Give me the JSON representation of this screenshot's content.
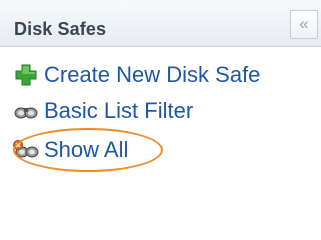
{
  "panel": {
    "title": "Disk Safes",
    "collapse_glyph": "«"
  },
  "menu": {
    "items": [
      {
        "label": "Create New Disk Safe",
        "icon": "add-icon",
        "color": "#3aa63a"
      },
      {
        "label": "Basic List Filter",
        "icon": "filter-icon",
        "color": "#555555"
      },
      {
        "label": "Show All",
        "icon": "filter-clear-icon",
        "color": "#555555"
      }
    ]
  },
  "colors": {
    "link": "#1f57a6",
    "highlight": "#f08a24"
  }
}
